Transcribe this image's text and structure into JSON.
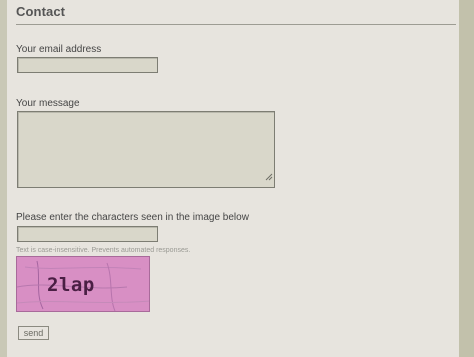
{
  "form": {
    "title": "Contact",
    "email_label": "Your email address",
    "email_value": "",
    "message_label": "Your message",
    "message_value": "",
    "captcha_label": "Please enter the characters seen in the image below",
    "captcha_value": "",
    "captcha_hint": "Text is case-insensitive. Prevents automated responses.",
    "captcha_image_text": "2lap",
    "send_label": "send"
  },
  "colors": {
    "captcha_background": "#d88fc4",
    "page_background": "#e7e4de"
  }
}
